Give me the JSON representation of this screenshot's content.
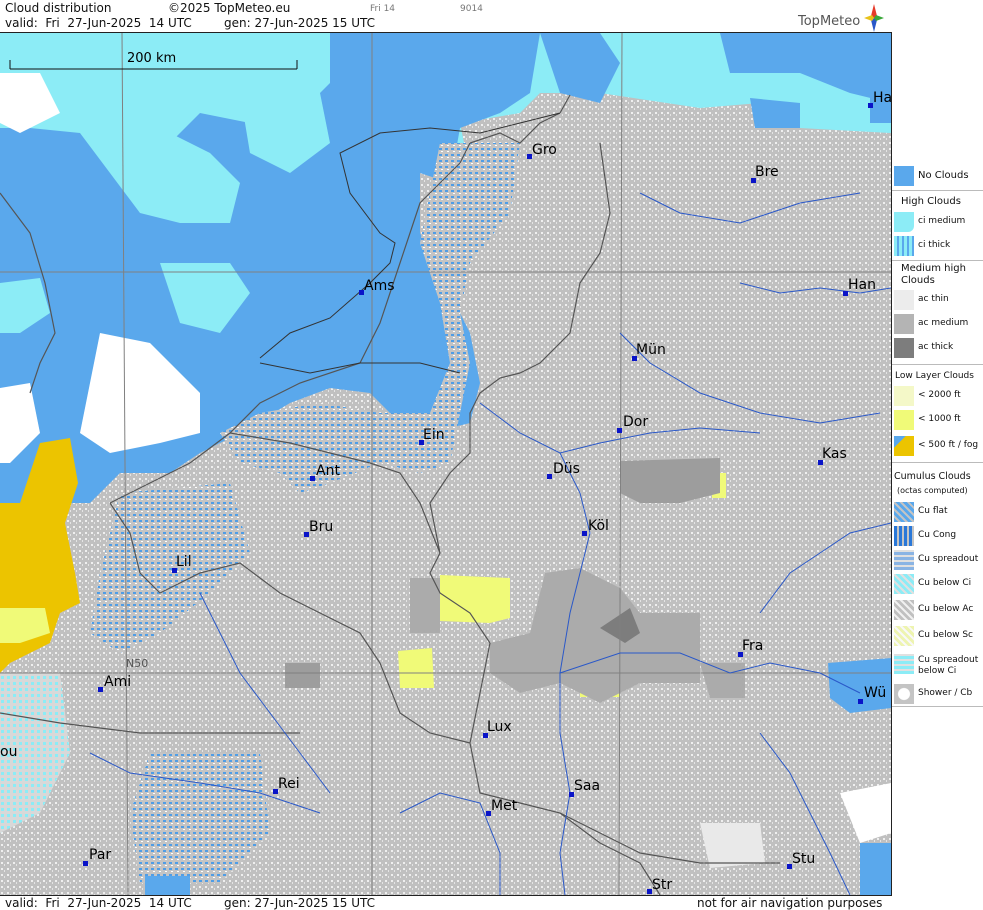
{
  "header": {
    "title": "Cloud distribution",
    "copyright": "©2025 TopMeteo.eu",
    "slot": "Fri 14",
    "code": "9014",
    "valid": "valid:  Fri  27-Jun-2025  14 UTC",
    "gen": "gen: 27-Jun-2025 15 UTC",
    "brand": "TopMeteo"
  },
  "map": {
    "scale_label": "200 km",
    "lat_label": "N50",
    "cities": [
      {
        "name": "Ha"
      },
      {
        "name": "Gro"
      },
      {
        "name": "Bre"
      },
      {
        "name": "Ams"
      },
      {
        "name": "Han"
      },
      {
        "name": "Mün"
      },
      {
        "name": "Ein"
      },
      {
        "name": "Dor"
      },
      {
        "name": "Kas"
      },
      {
        "name": "Ant"
      },
      {
        "name": "Düs"
      },
      {
        "name": "Bru"
      },
      {
        "name": "Köl"
      },
      {
        "name": "Lil"
      },
      {
        "name": "Fra"
      },
      {
        "name": "Ami"
      },
      {
        "name": "Wü"
      },
      {
        "name": "Lux"
      },
      {
        "name": "ou"
      },
      {
        "name": "Rei"
      },
      {
        "name": "Saa"
      },
      {
        "name": "Met"
      },
      {
        "name": "Par"
      },
      {
        "name": "Stu"
      },
      {
        "name": "Str"
      }
    ]
  },
  "legend": {
    "no_clouds": "No Clouds",
    "high_clouds": "High Clouds",
    "ci_medium": "ci medium",
    "ci_thick": "ci thick",
    "medium_high": "Medium high\nClouds",
    "ac_thin": "ac thin",
    "ac_medium": "ac medium",
    "ac_thick": "ac thick",
    "low_layer": "Low Layer Clouds",
    "low_2000": "< 2000 ft",
    "low_1000": "< 1000 ft",
    "low_500": "< 500 ft / fog",
    "cumulus": "Cumulus Clouds",
    "octas": "(octas computed)",
    "cu_flat": "Cu flat",
    "cu_cong": "Cu Cong",
    "cu_spreadout": "Cu spreadout",
    "cu_below_ci": "Cu below Ci",
    "cu_below_ac": "Cu below Ac",
    "cu_below_sc": "Cu below Sc",
    "cu_spreadout_below_ci": "Cu spreadout\nbelow Ci",
    "shower": "Shower / Cb"
  },
  "footer": {
    "valid": "valid:  Fri  27-Jun-2025  14 UTC",
    "gen": "gen: 27-Jun-2025 15 UTC",
    "note": "not for air navigation purposes"
  },
  "colors": {
    "no_clouds": "#5aa8ec",
    "ci_medium": "#8cecf6",
    "ac_medium": "#b4b4b4",
    "ac_thick": "#8a8a8a",
    "low_1000": "#f0fa78",
    "fog": "#ecc400",
    "border": "#555555",
    "river": "#2a58c8"
  }
}
